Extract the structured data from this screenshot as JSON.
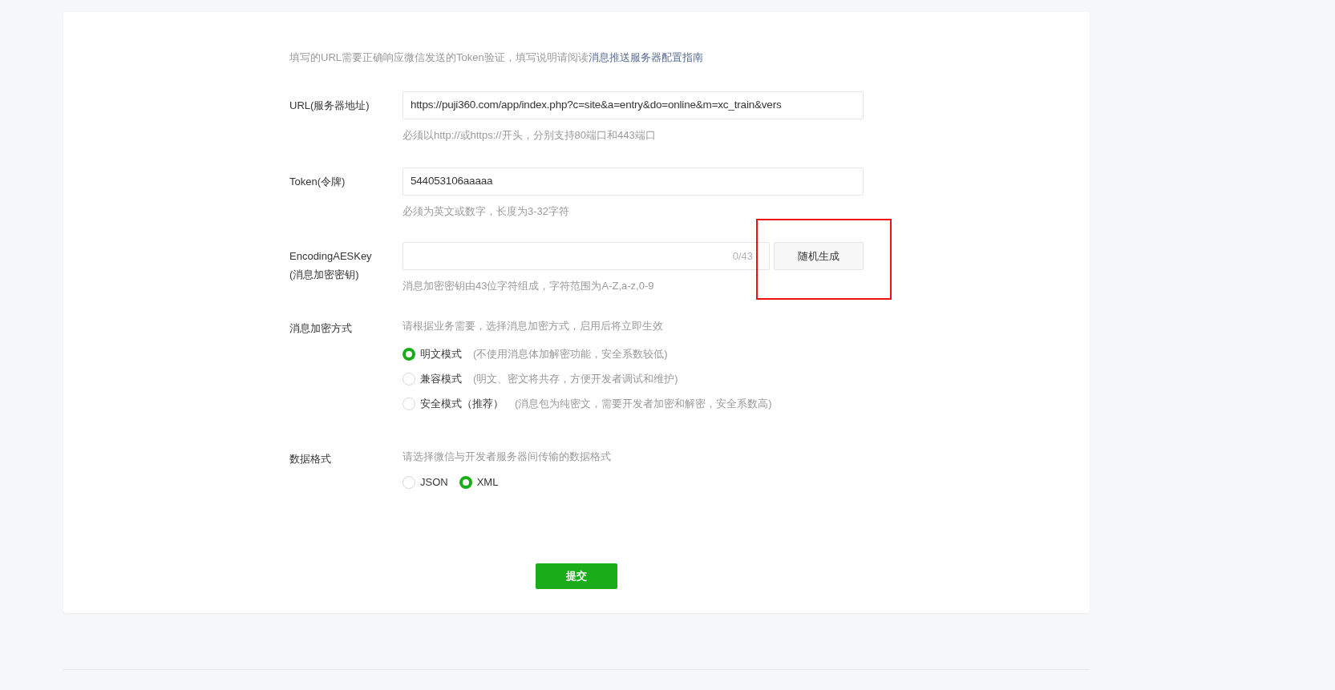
{
  "intro": {
    "text": "填写的URL需要正确响应微信发送的Token验证，填写说明请阅读",
    "link": "消息推送服务器配置指南"
  },
  "fields": [
    {
      "kind": "text",
      "label": "URL(服务器地址)",
      "value": "https://puji360.com/app/index.php?c=site&a=entry&do=online&m=xc_train&vers",
      "hint": "必须以http://或https://开头，分别支持80端口和443端口"
    },
    {
      "kind": "text",
      "label": "Token(令牌)",
      "value": "544053106aaaaa",
      "hint": "必须为英文或数字，长度为3-32字符"
    },
    {
      "kind": "key",
      "label": "EncodingAESKey",
      "sublabel": "(消息加密密钥)",
      "counter": "0/43",
      "button": "随机生成",
      "hint": "消息加密密钥由43位字符组成，字符范围为A-Z,a-z,0-9"
    }
  ],
  "encryption": {
    "label": "消息加密方式",
    "hint": "请根据业务需要，选择消息加密方式，启用后将立即生效",
    "options": [
      {
        "name": "明文模式",
        "note": "(不使用消息体加解密功能，安全系数较低)",
        "selected": true
      },
      {
        "name": "兼容模式",
        "note": "(明文、密文将共存，方便开发者调试和维护)",
        "selected": false
      },
      {
        "name": "安全模式（推荐）",
        "note": "(消息包为纯密文，需要开发者加密和解密，安全系数高)",
        "selected": false
      }
    ]
  },
  "data_format": {
    "label": "数据格式",
    "hint": "请选择微信与开发者服务器间传输的数据格式",
    "options": [
      {
        "name": "JSON",
        "selected": false
      },
      {
        "name": "XML",
        "selected": true
      }
    ]
  },
  "submit": "提交"
}
